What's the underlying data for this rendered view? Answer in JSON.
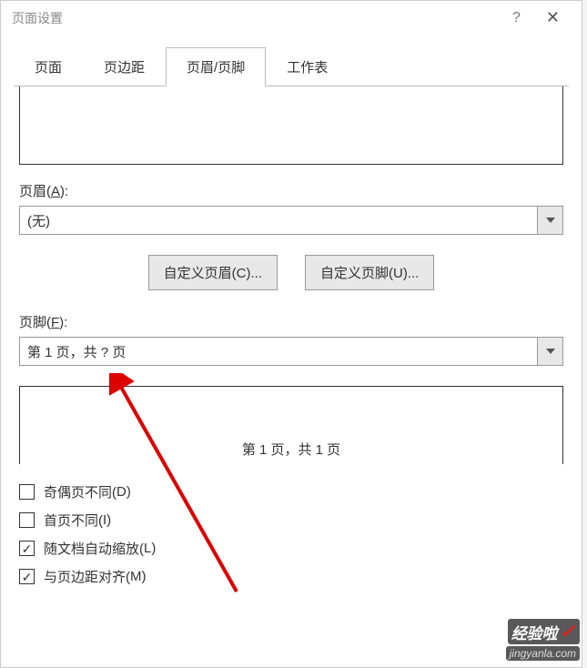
{
  "titlebar": {
    "title": "页面设置",
    "help": "?",
    "close": "✕"
  },
  "tabs": {
    "items": [
      "页面",
      "页边距",
      "页眉/页脚",
      "工作表"
    ],
    "activeIndex": 2
  },
  "header": {
    "label_prefix": "页眉(",
    "label_hotkey": "A",
    "label_suffix": "):",
    "value": "(无)"
  },
  "custom": {
    "header_btn_prefix": "自定义页眉(",
    "header_btn_hotkey": "C",
    "header_btn_suffix": ")...",
    "footer_btn_prefix": "自定义页脚(",
    "footer_btn_hotkey": "U",
    "footer_btn_suffix": ")..."
  },
  "footer": {
    "label_prefix": "页脚(",
    "label_hotkey": "F",
    "label_suffix": "):",
    "value": "第 1 页，共 ? 页",
    "preview": "第 1 页，共 1 页"
  },
  "checkboxes": [
    {
      "text_prefix": "奇偶页不同(",
      "hotkey": "D",
      "text_suffix": ")",
      "checked": false
    },
    {
      "text_prefix": "首页不同(",
      "hotkey": "I",
      "text_suffix": ")",
      "checked": false
    },
    {
      "text_prefix": "随文档自动缩放(",
      "hotkey": "L",
      "text_suffix": ")",
      "checked": true
    },
    {
      "text_prefix": "与页边距对齐(",
      "hotkey": "M",
      "text_suffix": ")",
      "checked": true
    }
  ],
  "watermark": {
    "line1": "经验啦",
    "line2": "jingyanla.com"
  }
}
